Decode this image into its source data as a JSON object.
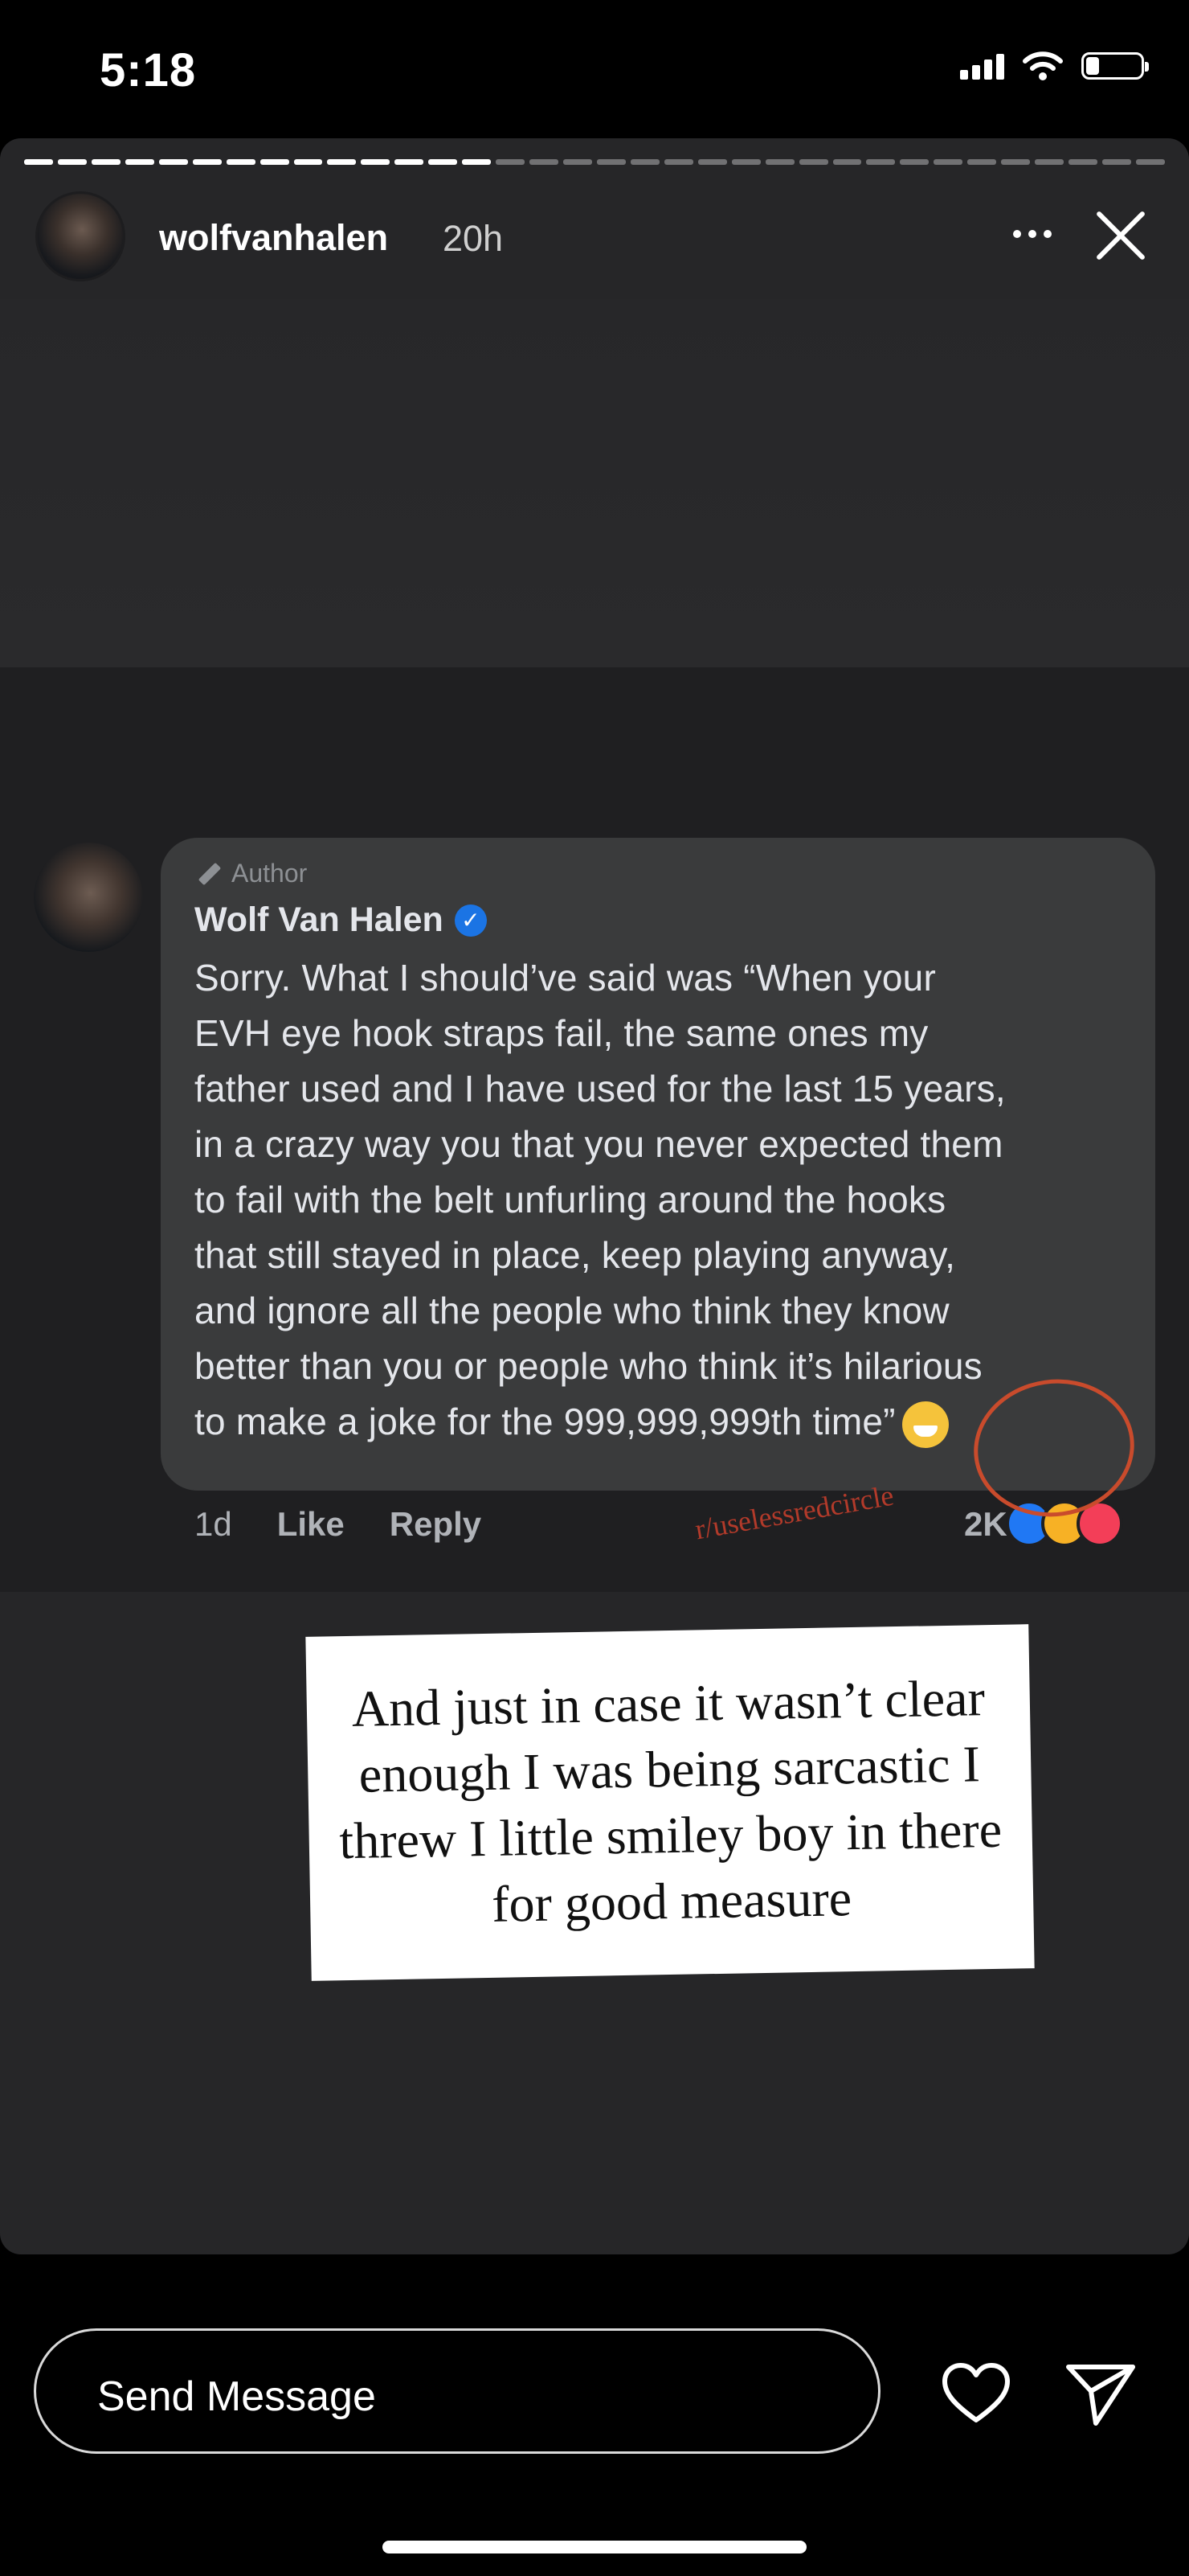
{
  "status_bar": {
    "time": "5:18"
  },
  "story": {
    "username": "wolfvanhalen",
    "time_ago": "20h",
    "progress": {
      "segments_total": 34,
      "segments_viewed": 14
    }
  },
  "comment": {
    "author_badge": "Author",
    "name": "Wolf Van Halen",
    "text": "Sorry. What I should’ve said was “When your\nEVH eye hook straps fail, the same ones my\nfather used and I have used for the last 15 years,\nin a crazy way you that you never expected them\nto fail with the belt unfurling around the hooks\nthat still stayed in place, keep playing anyway,\nand ignore all the people who think they know\nbetter than you or people who think it’s hilarious\nto make a joke for the 999,999,999th time”",
    "time": "1d",
    "like_label": "Like",
    "reply_label": "Reply",
    "reaction_count": "2K",
    "watermark": "r/uselessredcircle"
  },
  "caption": "And just in case it wasn’t clear enough I was being sarcastic I threw I little smiley boy in there for good measure",
  "footer": {
    "send_placeholder": "Send Message"
  },
  "colors": {
    "annotation_red": "#c94b2c",
    "verified_blue": "#1b74e4"
  }
}
